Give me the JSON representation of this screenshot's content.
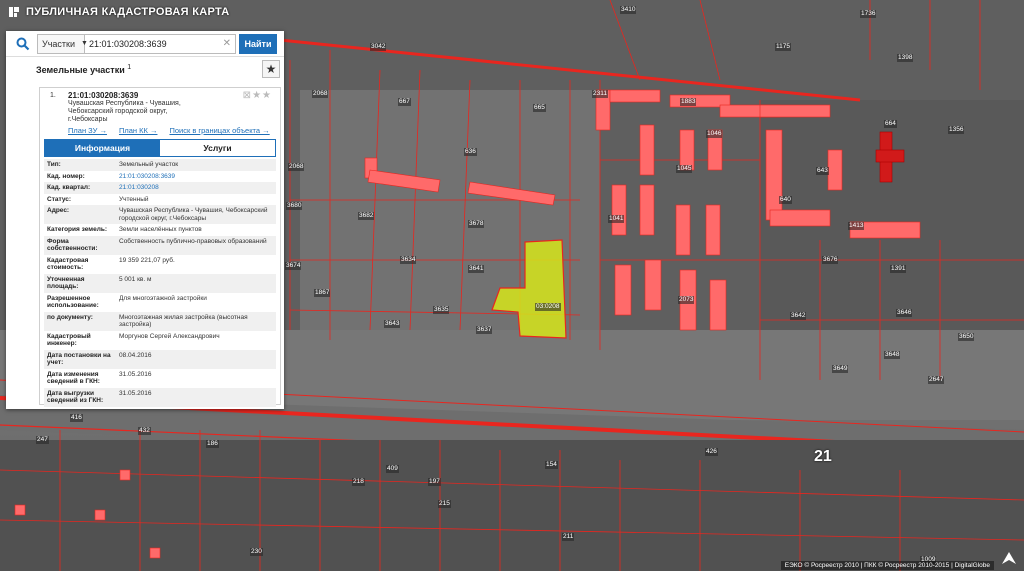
{
  "app": {
    "title": "ПУБЛИЧНАЯ КАДАСТРОВАЯ КАРТА"
  },
  "search": {
    "type_label": "Участки",
    "query": "21:01:030208:3639",
    "find_label": "Найти"
  },
  "results": {
    "title": "Земельные участки",
    "count": "1"
  },
  "card": {
    "number": "1.",
    "cad_id": "21:01:030208:3639",
    "address": "Чувашская Республика - Чувашия, Чебоксарский городской округ, г.Чебоксары",
    "links": [
      "План ЗУ →",
      "План КК →",
      "Поиск в границах объекта →"
    ],
    "tabs": [
      "Информация",
      "Услуги"
    ],
    "rows": [
      {
        "k": "Тип:",
        "v": "Земельный участок",
        "link": false
      },
      {
        "k": "Кад. номер:",
        "v": "21:01:030208:3639",
        "link": true
      },
      {
        "k": "Кад. квартал:",
        "v": "21:01:030208",
        "link": true
      },
      {
        "k": "Статус:",
        "v": "Учтенный",
        "link": false
      },
      {
        "k": "Адрес:",
        "v": "Чувашская Республика - Чувашия, Чебоксарский городской округ, г.Чебоксары",
        "link": false
      },
      {
        "k": "Категория земель:",
        "v": "Земли населённых пунктов",
        "link": false
      },
      {
        "k": "Форма собственности:",
        "v": "Собственность публично-правовых образований",
        "link": false
      },
      {
        "k": "Кадастровая стоимость:",
        "v": "19 359 221,07 руб.",
        "link": false
      },
      {
        "k": "Уточненная площадь:",
        "v": "5 001 кв. м",
        "link": false
      },
      {
        "k": "Разрешенное использование:",
        "v": "Для многоэтажной застройки",
        "link": false
      },
      {
        "k": "по документу:",
        "v": "Многоэтажная жилая застройка (высотная застройка)",
        "link": false
      },
      {
        "k": "Кадастровый инженер:",
        "v": "Моргунов Сергей Александрович",
        "link": false
      },
      {
        "k": "Дата постановки на учет:",
        "v": "08.04.2016",
        "link": false
      },
      {
        "k": "Дата изменения сведений в ГКН:",
        "v": "31.05.2016",
        "link": false
      },
      {
        "k": "Дата выгрузки сведений из ГКН:",
        "v": "31.05.2016",
        "link": false
      }
    ]
  },
  "map": {
    "road_label": "21",
    "parcel_labels": [
      "3042",
      "1175",
      "1736",
      "1398",
      "3410",
      "2068",
      "667",
      "665",
      "636",
      "2311",
      "1883",
      "1356",
      "664",
      "3680",
      "2068",
      "3682",
      "3678",
      "3634",
      "3641",
      "3676",
      "1391",
      "3674",
      "1867",
      "3643",
      "3635",
      "3637",
      "3642",
      "3646",
      "3650",
      "3649",
      "3648",
      "2647",
      "03:0208",
      "03020",
      "247",
      "416",
      "432",
      "186",
      "218",
      "197",
      "409",
      "215",
      "426",
      "154",
      "230",
      "211",
      "1009",
      "1045",
      "1046",
      "1041",
      "1413",
      "643",
      "640",
      "2073"
    ],
    "selected_parcel_color": "#d6e51a",
    "building_color": "#ff6a6a",
    "boundary_color": "#e8261f"
  },
  "attribution": "ЕЭКО © Росреестр 2010 | ПКК © Росреестр 2010-2015 | DigitalGlobe"
}
